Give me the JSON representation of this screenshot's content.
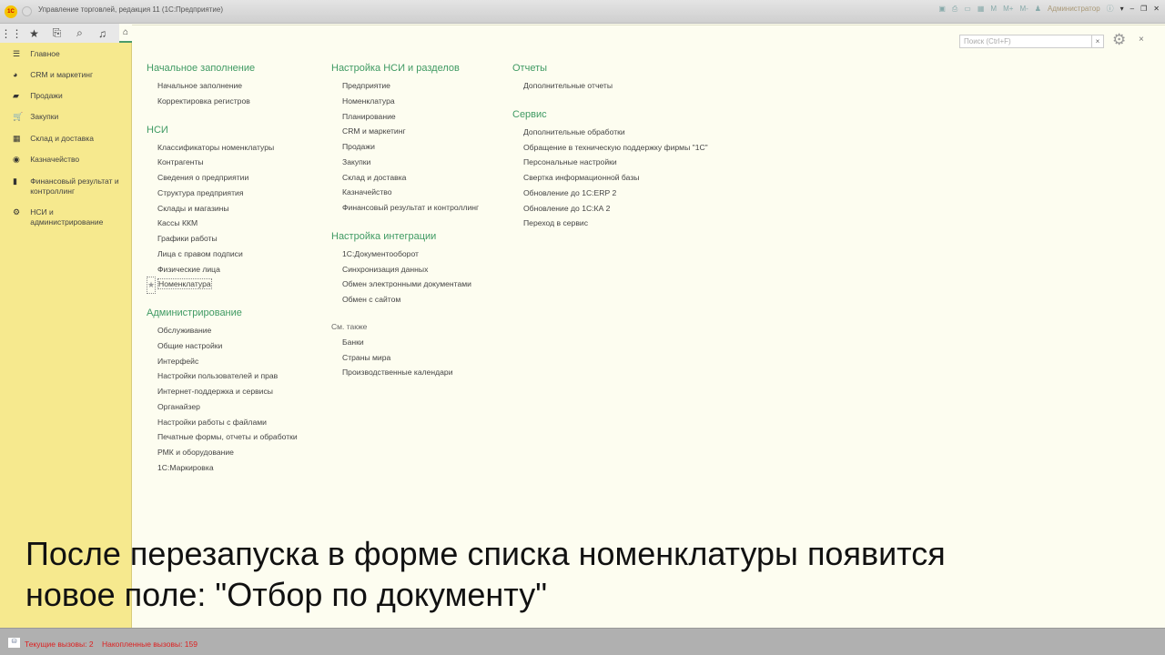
{
  "window": {
    "title": "Управление торговлей, редакция 11 (1С:Предприятие)",
    "logo": "1С",
    "user": "Администратор",
    "toolbar_labels": [
      "M",
      "M+",
      "M-"
    ]
  },
  "sidebar": {
    "items": [
      {
        "label": "Главное",
        "icon": "menu-icon"
      },
      {
        "label": "CRM и маркетинг",
        "icon": "pie-icon"
      },
      {
        "label": "Продажи",
        "icon": "bag-icon"
      },
      {
        "label": "Закупки",
        "icon": "cart-icon"
      },
      {
        "label": "Склад и доставка",
        "icon": "grid-icon"
      },
      {
        "label": "Казначейство",
        "icon": "coin-icon"
      },
      {
        "label": "Финансовый результат и контроллинг",
        "icon": "chart-icon"
      },
      {
        "label": "НСИ и администрирование",
        "icon": "gear-icon"
      }
    ]
  },
  "search": {
    "placeholder": "Поиск (Ctrl+F)",
    "clear": "×"
  },
  "close": "×",
  "columns": [
    [
      {
        "title": "Начальное заполнение",
        "items": [
          "Начальное заполнение",
          "Корректировка регистров"
        ]
      },
      {
        "title": "НСИ",
        "items": [
          "Классификаторы номенклатуры",
          "Контрагенты",
          "Сведения о предприятии",
          "Структура предприятия",
          "Склады и магазины",
          "Кассы ККМ",
          "Графики работы",
          "Лица с правом подписи",
          "Физические лица",
          "Номенклатура"
        ]
      },
      {
        "title": "Администрирование",
        "items": [
          "Обслуживание",
          "Общие настройки",
          "Интерфейс",
          "Настройки пользователей и прав",
          "Интернет-поддержка и сервисы",
          "Органайзер",
          "Настройки работы с файлами",
          "Печатные формы, отчеты и обработки",
          "РМК и оборудование",
          "1С:Маркировка"
        ]
      }
    ],
    [
      {
        "title": "Настройка НСИ и разделов",
        "items": [
          "Предприятие",
          "Номенклатура",
          "Планирование",
          "CRM и маркетинг",
          "Продажи",
          "Закупки",
          "Склад и доставка",
          "Казначейство",
          "Финансовый результат и контроллинг"
        ]
      },
      {
        "title": "Настройка интеграции",
        "items": [
          "1С:Документооборот",
          "Синхронизация данных",
          "Обмен электронными документами",
          "Обмен с сайтом"
        ]
      }
    ],
    [
      {
        "title": "Отчеты",
        "items": [
          "Дополнительные отчеты"
        ]
      },
      {
        "title": "Сервис",
        "items": [
          "Дополнительные обработки",
          "Обращение в техническую поддержку фирмы \"1С\"",
          "Персональные настройки",
          "Свертка информационной базы",
          "Обновление до 1С:ERP 2",
          "Обновление до 1С:КА 2",
          "Переход в сервис"
        ]
      }
    ]
  ],
  "see_also": {
    "label": "См. также",
    "items": [
      "Банки",
      "Страны мира",
      "Производственные календари"
    ]
  },
  "subtitle": {
    "line1": "После перезапуска в форме списка номенклатуры появится",
    "line2": "новое поле: \"Отбор по документу\""
  },
  "status": {
    "current": "Текущие вызовы: 2",
    "accumulated": "Накопленные вызовы: 159"
  }
}
